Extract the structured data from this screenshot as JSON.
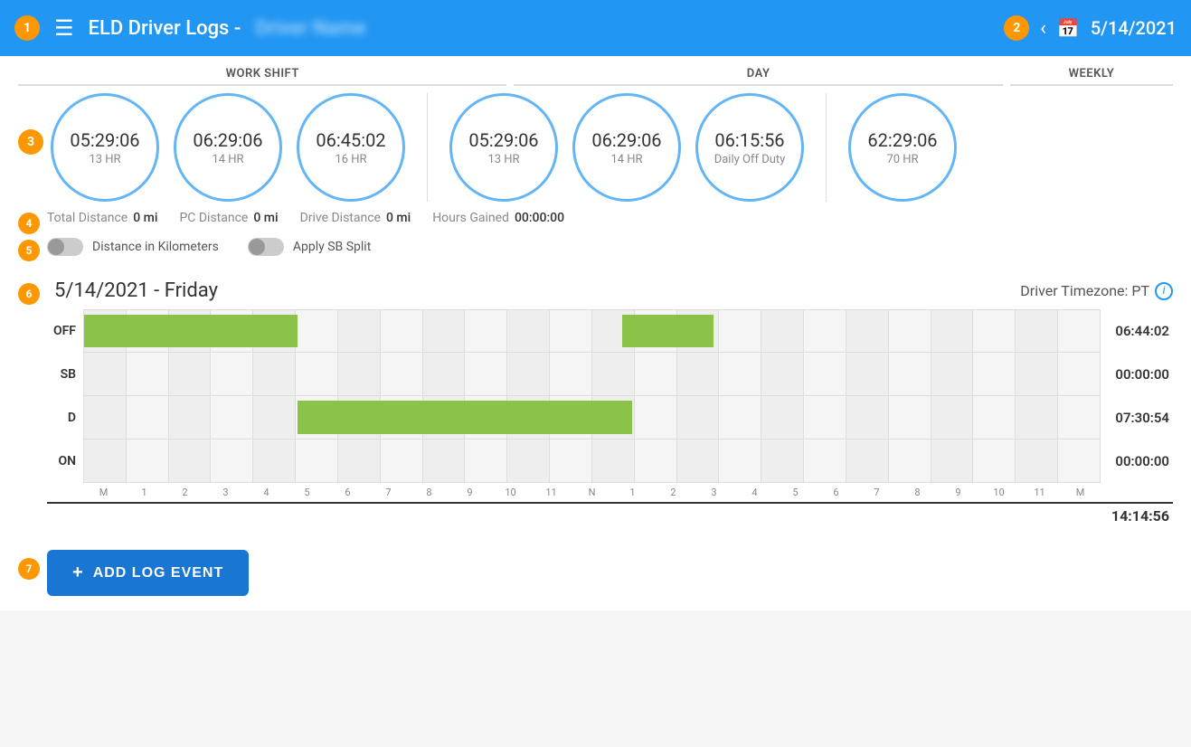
{
  "header": {
    "title": "ELD Driver Logs -",
    "driver_name": "Driver Name",
    "date": "5/14/2021",
    "back_label": "‹",
    "menu_icon": "☰",
    "calendar_icon": "📅"
  },
  "badges": {
    "step1": "1",
    "step2": "2",
    "step3": "3",
    "step4": "4",
    "step5": "5",
    "step6": "6",
    "step7": "7"
  },
  "sections": {
    "work_shift": "WORK SHIFT",
    "day": "DAY",
    "weekly": "WEEKLY"
  },
  "circles": [
    {
      "id": "ws1",
      "time": "05:29:06",
      "label": "13 HR"
    },
    {
      "id": "ws2",
      "time": "06:29:06",
      "label": "14 HR"
    },
    {
      "id": "ws3",
      "time": "06:45:02",
      "label": "16 HR"
    },
    {
      "id": "day1",
      "time": "05:29:06",
      "label": "13 HR"
    },
    {
      "id": "day2",
      "time": "06:29:06",
      "label": "14 HR"
    },
    {
      "id": "day3",
      "time": "06:15:56",
      "label": "Daily Off Duty"
    },
    {
      "id": "wk1",
      "time": "62:29:06",
      "label": "70 HR"
    }
  ],
  "distances": {
    "total_label": "Total Distance",
    "total_value": "0 mi",
    "pc_label": "PC Distance",
    "pc_value": "0 mi",
    "drive_label": "Drive Distance",
    "drive_value": "0 mi",
    "hours_label": "Hours Gained",
    "hours_value": "00:00:00"
  },
  "toggles": {
    "km_label": "Distance in Kilometers",
    "sb_label": "Apply SB Split"
  },
  "chart": {
    "date_label": "5/14/2021 - Friday",
    "timezone_label": "Driver Timezone: PT",
    "rows": [
      {
        "label": "OFF",
        "value": "06:44:02"
      },
      {
        "label": "SB",
        "value": "00:00:00"
      },
      {
        "label": "D",
        "value": "07:30:54"
      },
      {
        "label": "ON",
        "value": "00:00:00"
      }
    ],
    "total": "14:14:56",
    "xaxis": [
      "M",
      "1",
      "2",
      "3",
      "4",
      "5",
      "6",
      "7",
      "8",
      "9",
      "10",
      "11",
      "N",
      "1",
      "2",
      "3",
      "4",
      "5",
      "6",
      "7",
      "8",
      "9",
      "10",
      "11",
      "M"
    ]
  },
  "buttons": {
    "add_log": "ADD LOG EVENT"
  }
}
